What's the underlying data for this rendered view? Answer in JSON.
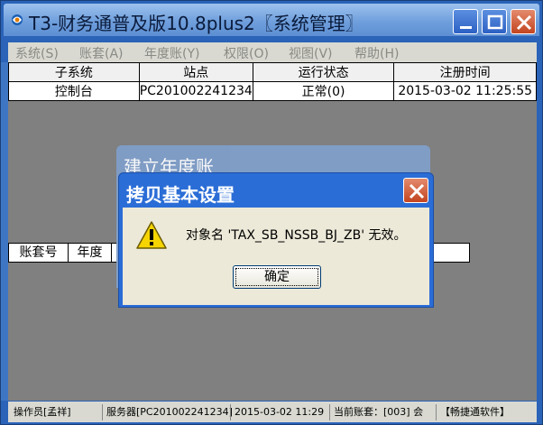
{
  "window": {
    "title": "T3-财务通普及版10.8plus2〖系统管理〗",
    "icon": "app-logo-icon"
  },
  "menu": [
    {
      "label": "系统(S)"
    },
    {
      "label": "账套(A)"
    },
    {
      "label": "年度账(Y)"
    },
    {
      "label": "权限(O)"
    },
    {
      "label": "视图(V)"
    },
    {
      "label": "帮助(H)"
    }
  ],
  "table": {
    "headers": [
      "子系统",
      "站点",
      "运行状态",
      "注册时间"
    ],
    "rows": [
      [
        "控制台",
        "PC201002241234",
        "正常(0)",
        "2015-03-02 11:25:55"
      ]
    ]
  },
  "back_dialog": {
    "title": "建立年度账",
    "columns": [
      "账套号",
      "年度"
    ]
  },
  "dialog": {
    "title": "拷贝基本设置",
    "message": "对象名 'TAX_SB_NSSB_BJ_ZB' 无效。",
    "ok_label": "确定"
  },
  "status": {
    "operator": "操作员[孟祥]",
    "server": "服务器[PC201002241234]",
    "date": "2015-03-02 11:29",
    "account": "当前账套：[003] 会",
    "brand": "【畅捷通软件】"
  },
  "colors": {
    "titlebar": "#6f9fdc",
    "dialog_frame": "#2b6dd6",
    "close_red": "#c3451f",
    "workspace_gray": "#808080"
  }
}
